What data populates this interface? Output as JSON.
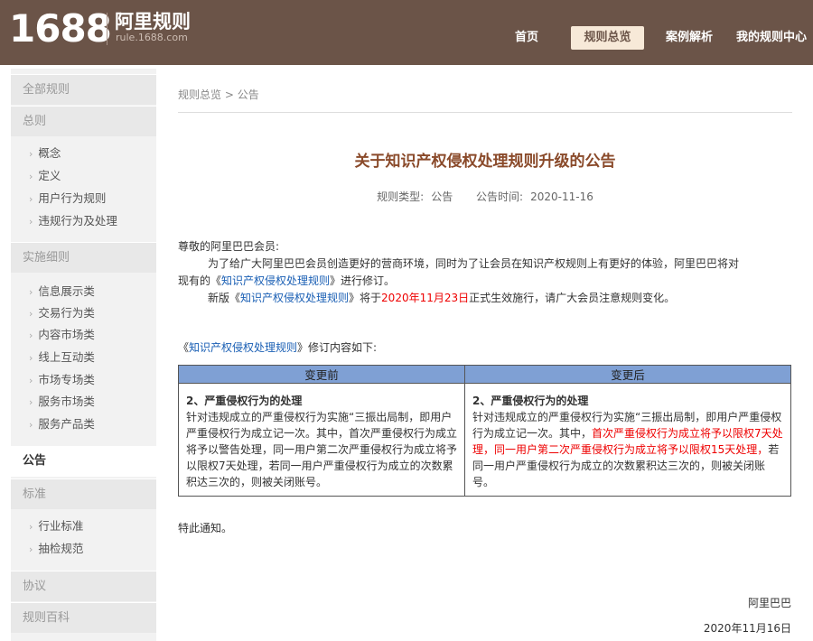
{
  "header": {
    "logo_number": "1688",
    "logo_cn": "阿里规则",
    "logo_url": "rule.1688.com",
    "nav": [
      {
        "label": "首页"
      },
      {
        "label": "规则总览"
      },
      {
        "label": "案例解析"
      },
      {
        "label": "我的规则中心"
      }
    ],
    "active_nav": "规则总览"
  },
  "sidebar": {
    "all_rules": "全部规则",
    "general": {
      "heading": "总则",
      "items": [
        "概念",
        "定义",
        "用户行为规则",
        "违规行为及处理"
      ]
    },
    "details": {
      "heading": "实施细则",
      "items": [
        "信息展示类",
        "交易行为类",
        "内容市场类",
        "线上互动类",
        "市场专场类",
        "服务市场类",
        "服务产品类"
      ]
    },
    "announcement": "公告",
    "standards": {
      "heading": "标准",
      "items": [
        "行业标准",
        "抽检规范"
      ]
    },
    "agreement": "协议",
    "encyclopedia": "规则百科"
  },
  "breadcrumb": {
    "root": "规则总览",
    "sep": " > ",
    "current": "公告"
  },
  "article": {
    "title": "关于知识产权侵权处理规则升级的公告",
    "type_label": "规则类型:",
    "type_value": "公告",
    "time_label": "公告时间:",
    "time_value": "2020-11-16",
    "greeting": "尊敬的阿里巴巴会员:",
    "p1_a": "为了给广大阿里巴巴会员创造更好的营商环境，同时为了让会员在知识产权规则上有更好的体验，阿里巴巴将对",
    "p1_b": "现有的《",
    "p1_link": "知识产权侵权处理规则",
    "p1_c": "》进行修订。",
    "p2_a": "新版《",
    "p2_link": "知识产权侵权处理规则",
    "p2_b": "》将于",
    "p2_date": "2020年11月23日",
    "p2_c": "正式生效施行，请广大会员注意规则变化。",
    "rev_a": "《",
    "rev_link": "知识产权侵权处理规则",
    "rev_b": "》修订内容如下:",
    "table": {
      "col_before": "变更前",
      "col_after": "变更后",
      "before_title": "2、严重侵权行为的处理",
      "before_body": "针对违规成立的严重侵权行为实施“三振出局制，即用户严重侵权行为成立记一次。其中，首次严重侵权行为成立将予以警告处理，同一用户第二次严重侵权行为成立将予以限权7天处理，若同一用户严重侵权行为成立的次数累积达三次的，则被关闭账号。",
      "after_title": "2、严重侵权行为的处理",
      "after_body_a": "针对违规成立的严重侵权行为实施“三振出局制，即用户严重侵权行为成立记一次。其中，",
      "after_body_red": "首次严重侵权行为成立将予以限权7天处理，同一用户第二次严重侵权行为成立将予以限权15天处理，",
      "after_body_b": "若同一用户严重侵权行为成立的次数累积达三次的，则被关闭账号。"
    },
    "closing": "特此通知。",
    "signature": "阿里巴巴",
    "date": "2020年11月16日"
  }
}
